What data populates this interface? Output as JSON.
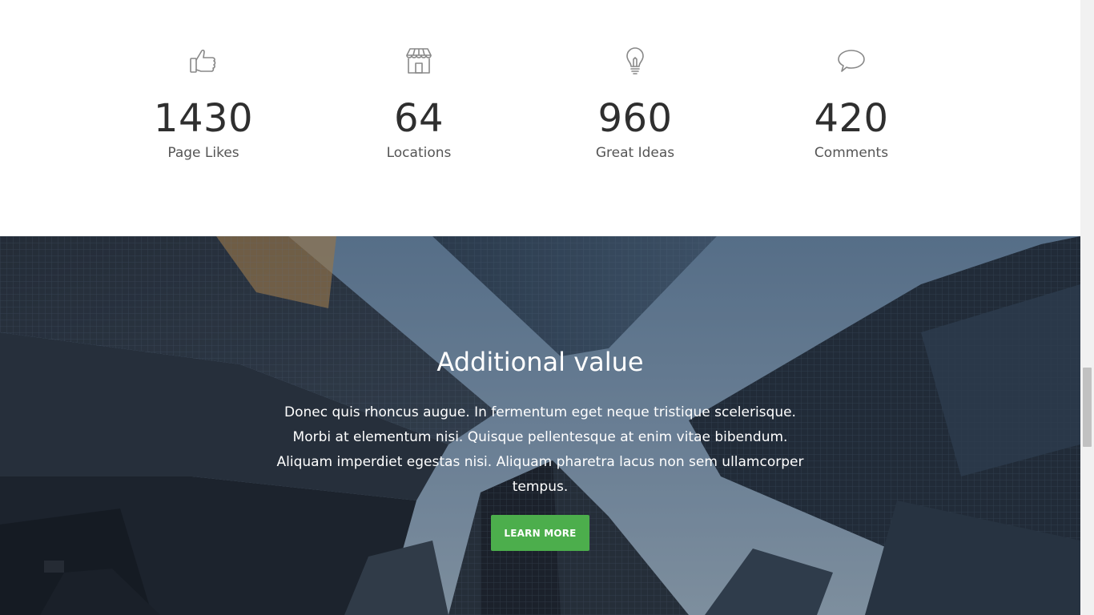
{
  "stats": [
    {
      "icon": "thumbs-up-icon",
      "value": "1430",
      "label": "Page Likes"
    },
    {
      "icon": "store-icon",
      "value": "64",
      "label": "Locations"
    },
    {
      "icon": "lightbulb-icon",
      "value": "960",
      "label": "Great Ideas"
    },
    {
      "icon": "speech-bubble-icon",
      "value": "420",
      "label": "Comments"
    }
  ],
  "hero": {
    "title": "Additional value",
    "text": "Donec quis rhoncus augue. In fermentum eget neque tristique scelerisque. Morbi at elementum nisi. Quisque pellentesque at enim vitae bibendum. Aliquam imperdiet egestas nisi. Aliquam pharetra lacus non sem ullamcorper tempus.",
    "button_label": "LEARN MORE",
    "background": "city-skyscrapers-looking-up"
  },
  "colors": {
    "button": "#4cae4c",
    "number_text": "#2f2f2f",
    "label_text": "#555555",
    "icon_stroke": "#888888"
  }
}
